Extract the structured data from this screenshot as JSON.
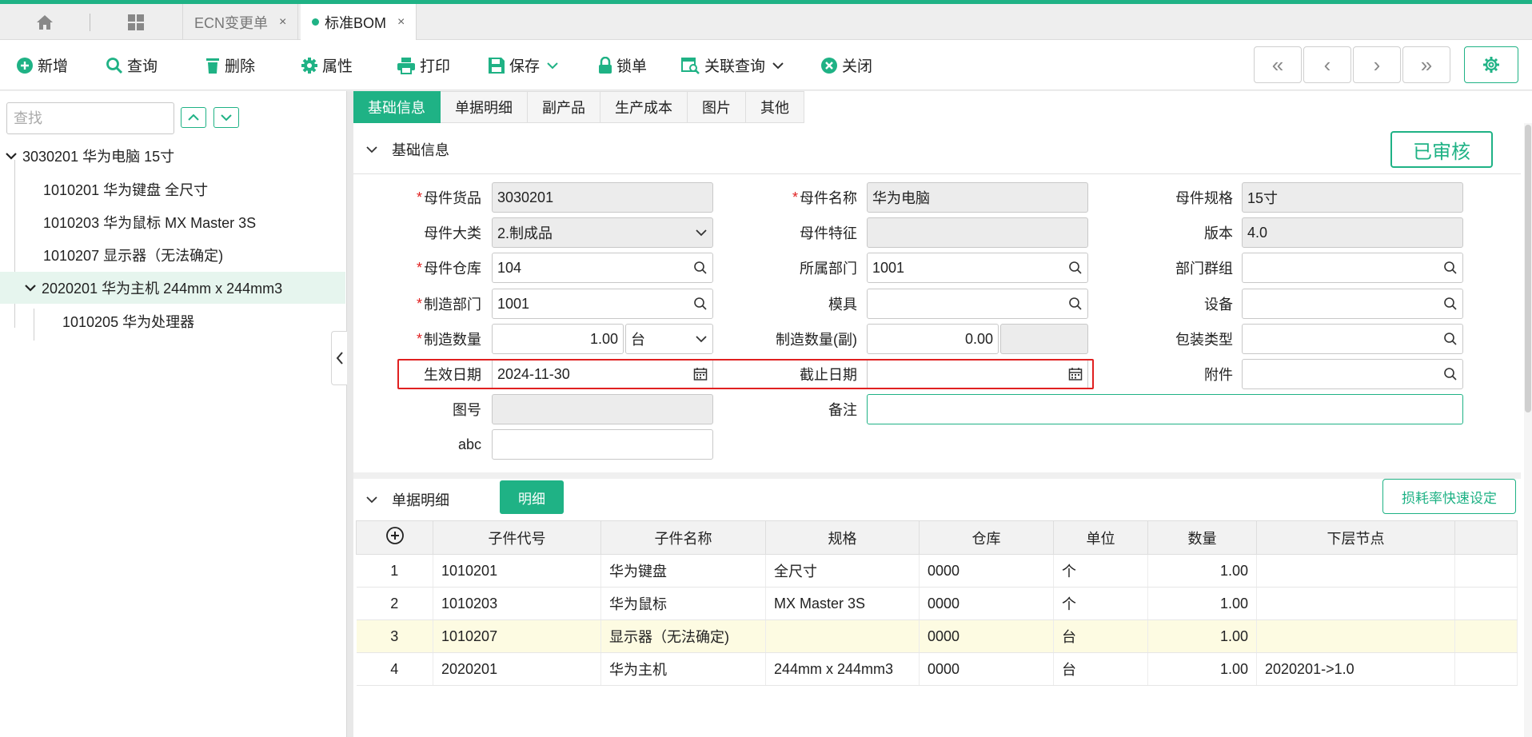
{
  "tabs": {
    "ecn": "ECN变更单",
    "bom": "标准BOM",
    "close": "×"
  },
  "toolbar": {
    "add": "新增",
    "query": "查询",
    "delete": "删除",
    "props": "属性",
    "print": "打印",
    "save": "保存",
    "lock": "锁单",
    "related": "关联查询",
    "close": "关闭",
    "first": "«",
    "prev": "‹",
    "next": "›",
    "last": "»"
  },
  "tree": {
    "search_placeholder": "查找",
    "items": [
      "3030201 华为电脑 15寸",
      "1010201 华为键盘 全尺寸",
      "1010203 华为鼠标 MX Master 3S",
      "1010207 显示器（无法确定)",
      "2020201 华为主机 244mm x 244mm3",
      "1010205 华为处理器"
    ]
  },
  "main_tabs": [
    "基础信息",
    "单据明细",
    "副产品",
    "生产成本",
    "图片",
    "其他"
  ],
  "basic": {
    "title": "基础信息",
    "status": "已审核",
    "labels": {
      "parent_code": "母件货品",
      "parent_name": "母件名称",
      "parent_spec": "母件规格",
      "category": "母件大类",
      "feature": "母件特征",
      "version": "版本",
      "warehouse": "母件仓库",
      "dept": "所属部门",
      "dept_group": "部门群组",
      "mfg_dept": "制造部门",
      "mold": "模具",
      "equipment": "设备",
      "mfg_qty": "制造数量",
      "mfg_qty_sub": "制造数量(副)",
      "pack_type": "包装类型",
      "eff_date": "生效日期",
      "end_date": "截止日期",
      "attachment": "附件",
      "drawing": "图号",
      "remark": "备注",
      "abc": "abc"
    },
    "values": {
      "parent_code": "3030201",
      "parent_name": "华为电脑",
      "parent_spec": "15寸",
      "category": "2.制成品",
      "version": "4.0",
      "warehouse": "104",
      "dept": "1001",
      "mfg_dept": "1001",
      "mfg_qty": "1.00",
      "unit": "台",
      "mfg_qty_sub": "0.00",
      "eff_date": "2024-11-30"
    },
    "required_mark": "*"
  },
  "detail": {
    "title": "单据明细",
    "detail_btn": "明细",
    "loss_btn": "损耗率快速设定",
    "columns": [
      "子件代号",
      "子件名称",
      "规格",
      "仓库",
      "单位",
      "数量",
      "下层节点"
    ],
    "rows": [
      {
        "no": "1",
        "code": "1010201",
        "name": "华为键盘",
        "spec": "全尺寸",
        "wh": "0000",
        "unit": "个",
        "qty": "1.00",
        "node": ""
      },
      {
        "no": "2",
        "code": "1010203",
        "name": "华为鼠标",
        "spec": "MX Master 3S",
        "wh": "0000",
        "unit": "个",
        "qty": "1.00",
        "node": ""
      },
      {
        "no": "3",
        "code": "1010207",
        "name": "显示器（无法确定)",
        "spec": "",
        "wh": "0000",
        "unit": "台",
        "qty": "1.00",
        "node": ""
      },
      {
        "no": "4",
        "code": "2020201",
        "name": "华为主机",
        "spec": "244mm x 244mm3",
        "wh": "0000",
        "unit": "台",
        "qty": "1.00",
        "node": "2020201->1.0"
      }
    ]
  },
  "colors": {
    "accent": "#1fb285",
    "required": "#e02020",
    "highlight_row": "#fdfbe2"
  }
}
